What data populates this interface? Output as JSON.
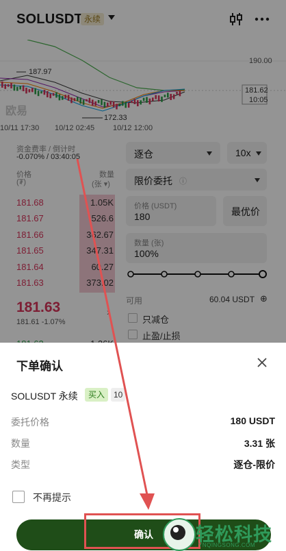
{
  "header": {
    "symbol": "SOLUSDT",
    "perp_badge": "永续",
    "candle_icon": "candlestick-icon",
    "more_icon": "more-icon"
  },
  "chart": {
    "price_label_top": "190.00",
    "current_price": "181.62",
    "countdown": "10:05",
    "high_marker": "187.97",
    "low_marker": "172.33",
    "x_labels": [
      "10/11 17:30",
      "10/12 02:45",
      "10/12 12:00"
    ],
    "watermark": "欧易"
  },
  "funding": {
    "label": "资金费率 / 倒计时",
    "value": "-0.070% / 03:40:05"
  },
  "orderbook": {
    "price_header": "价格",
    "price_unit": "(₮)",
    "qty_header": "数量",
    "qty_unit": "(张 ▾)",
    "asks": [
      {
        "price": "181.68",
        "qty": "1.05K"
      },
      {
        "price": "181.67",
        "qty": "526.6"
      },
      {
        "price": "181.66",
        "qty": "362.67"
      },
      {
        "price": "181.65",
        "qty": "347.31"
      },
      {
        "price": "181.64",
        "qty": "60.27"
      },
      {
        "price": "181.63",
        "qty": "373.02"
      }
    ],
    "last_price": "181.63",
    "last_sub": "181.61 -1.07%",
    "bid_partial": {
      "price": "181.62",
      "qty": "1.26K"
    }
  },
  "order_form": {
    "margin_mode": "逐仓",
    "leverage": "10x",
    "order_type": "限价委托",
    "price_label": "价格 (USDT)",
    "price_value": "180",
    "best_price_label": "最优价",
    "qty_label": "数量 (张)",
    "qty_value": "100%",
    "available_label": "可用",
    "available_value": "60.04 USDT",
    "reduce_only": "只减仓",
    "tp_sl": "止盈/止损"
  },
  "confirm_sheet": {
    "title": "下单确认",
    "symbol": "SOLUSDT 永续",
    "side": "买入",
    "leverage_badge": "10",
    "rows": [
      {
        "label": "委托价格",
        "value": "180 USDT"
      },
      {
        "label": "数量",
        "value": "3.31 张"
      },
      {
        "label": "类型",
        "value": "逐仓-限价"
      }
    ],
    "no_remind": "不再提示",
    "confirm_button": "确认"
  },
  "watermark": {
    "text": "轻松科技",
    "sub": "YNQINGSONG.COM"
  },
  "colors": {
    "ask_red": "#d8345b",
    "confirm_green": "#1f4d18",
    "annotation_red": "#e05252"
  }
}
